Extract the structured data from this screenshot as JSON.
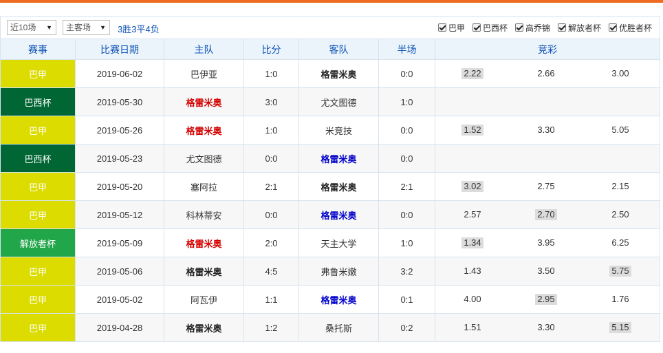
{
  "filters": {
    "range_select": "近10场",
    "venue_select": "主客场",
    "summary": "3胜3平4负",
    "leagues": [
      {
        "label": "巴甲",
        "checked": true
      },
      {
        "label": "巴西杯",
        "checked": true
      },
      {
        "label": "高乔锦",
        "checked": true
      },
      {
        "label": "解放者杯",
        "checked": true
      },
      {
        "label": "优胜者杯",
        "checked": true
      }
    ]
  },
  "table": {
    "headers": {
      "league": "赛事",
      "date": "比赛日期",
      "home": "主队",
      "score": "比分",
      "away": "客队",
      "half": "半场",
      "odds": "竞彩"
    },
    "rows": [
      {
        "league": "巴甲",
        "league_color": "#dcdc00",
        "date": "2019-06-02",
        "home": "巴伊亚",
        "score": "1:0",
        "away": "格雷米奥",
        "half": "0:0",
        "odds": [
          "2.22",
          "2.66",
          "3.00"
        ],
        "odds_mark": [
          true,
          false,
          false
        ]
      },
      {
        "league": "巴西杯",
        "league_color": "#006633",
        "date": "2019-05-30",
        "home": "格雷米奥",
        "score": "3:0",
        "away": "尤文图德",
        "half": "1:0",
        "odds": [
          "",
          "",
          ""
        ],
        "odds_mark": [
          false,
          false,
          false
        ]
      },
      {
        "league": "巴甲",
        "league_color": "#dcdc00",
        "date": "2019-05-26",
        "home": "格雷米奥",
        "score": "1:0",
        "away": "米竞技",
        "half": "0:0",
        "odds": [
          "1.52",
          "3.30",
          "5.05"
        ],
        "odds_mark": [
          true,
          false,
          false
        ]
      },
      {
        "league": "巴西杯",
        "league_color": "#006633",
        "date": "2019-05-23",
        "home": "尤文图德",
        "score": "0:0",
        "away": "格雷米奥",
        "half": "0:0",
        "odds": [
          "",
          "",
          ""
        ],
        "odds_mark": [
          false,
          false,
          false
        ]
      },
      {
        "league": "巴甲",
        "league_color": "#dcdc00",
        "date": "2019-05-20",
        "home": "塞阿拉",
        "score": "2:1",
        "away": "格雷米奥",
        "half": "2:1",
        "odds": [
          "3.02",
          "2.75",
          "2.15"
        ],
        "odds_mark": [
          true,
          false,
          false
        ]
      },
      {
        "league": "巴甲",
        "league_color": "#dcdc00",
        "date": "2019-05-12",
        "home": "科林蒂安",
        "score": "0:0",
        "away": "格雷米奥",
        "half": "0:0",
        "odds": [
          "2.57",
          "2.70",
          "2.50"
        ],
        "odds_mark": [
          false,
          true,
          false
        ]
      },
      {
        "league": "解放者杯",
        "league_color": "#22a64a",
        "date": "2019-05-09",
        "home": "格雷米奥",
        "score": "2:0",
        "away": "天主大学",
        "half": "1:0",
        "odds": [
          "1.34",
          "3.95",
          "6.25"
        ],
        "odds_mark": [
          true,
          false,
          false
        ]
      },
      {
        "league": "巴甲",
        "league_color": "#dcdc00",
        "date": "2019-05-06",
        "home": "格雷米奥",
        "score": "4:5",
        "away": "弗鲁米嫩",
        "half": "3:2",
        "odds": [
          "1.43",
          "3.50",
          "5.75"
        ],
        "odds_mark": [
          false,
          false,
          true
        ]
      },
      {
        "league": "巴甲",
        "league_color": "#dcdc00",
        "date": "2019-05-02",
        "home": "阿瓦伊",
        "score": "1:1",
        "away": "格雷米奥",
        "half": "0:1",
        "odds": [
          "4.00",
          "2.95",
          "1.76"
        ],
        "odds_mark": [
          false,
          true,
          false
        ]
      },
      {
        "league": "巴甲",
        "league_color": "#dcdc00",
        "date": "2019-04-28",
        "home": "格雷米奥",
        "score": "1:2",
        "away": "桑托斯",
        "half": "0:2",
        "odds": [
          "1.51",
          "3.30",
          "5.15"
        ],
        "odds_mark": [
          false,
          false,
          true
        ]
      }
    ]
  },
  "colors": {
    "win": "#d40000",
    "draw": "#0000cc",
    "loss": "#222222",
    "accent": "#ef6b1f",
    "header_text": "#0b50b4"
  },
  "highlight_team": "格雷米奥"
}
